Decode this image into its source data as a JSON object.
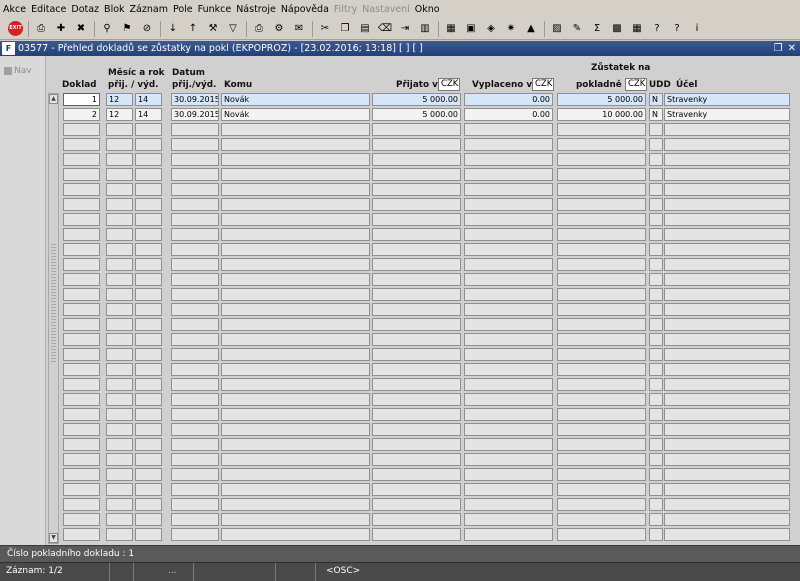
{
  "menu": [
    "Akce",
    "Editace",
    "Dotaz",
    "Blok",
    "Záznam",
    "Pole",
    "Funkce",
    "Nástroje",
    "Nápověda",
    "Filtry",
    "Nastavení",
    "Okno"
  ],
  "menu_disabled": [
    "Filtry",
    "Nastavení"
  ],
  "toolbar": {
    "exit_label": "EXIT",
    "icons": [
      "exit-icon",
      "sep",
      "print-preview-icon",
      "new-record-icon",
      "delete-record-icon",
      "sep",
      "query-icon",
      "execute-query-icon",
      "cancel-query-icon",
      "sep",
      "sort-asc-icon",
      "sort-desc-icon",
      "tools-icon",
      "filter-icon",
      "sep",
      "print-icon",
      "print-setup-icon",
      "mail-icon",
      "sep",
      "cut-icon",
      "copy-icon",
      "paste-icon",
      "clear-icon",
      "indent-icon",
      "columns-icon",
      "sep",
      "form-icon",
      "save-icon",
      "cube-icon",
      "star-icon",
      "warning-icon",
      "sep",
      "report-icon",
      "note-icon",
      "sum-icon",
      "excel-icon",
      "calc-icon",
      "help-icon",
      "question-icon",
      "info-icon"
    ]
  },
  "window": {
    "title": "03577 - Přehled dokladů se zůstatky na pokl (EKPOPROZ) - [23.02.2016; 13:18] [ ] [ ]",
    "icon_label": "F"
  },
  "nav": {
    "label": "Nav"
  },
  "headers": {
    "doklad": "Doklad",
    "mesic_rok": "Měsíc a rok",
    "prij_vyd": "přij. / výd.",
    "datum": "Datum",
    "datum_sub": "přij./výd.",
    "komu": "Komu",
    "prijato": "Přijato v",
    "prijato_cur": "CZK",
    "vyplaceno": "Vyplaceno v",
    "vyplaceno_cur": "CZK",
    "zustatek": "Zůstatek na",
    "zustatek_sub": "pokladně v",
    "zustatek_cur": "CZK",
    "udd": "UDD",
    "ucel": "Účel"
  },
  "rows": [
    {
      "doklad": "1",
      "mesic": "12",
      "rok": "14",
      "datum": "30.09.2015",
      "komu": "Novák",
      "prijato": "5 000.00",
      "vyplaceno": "0.00",
      "zustatek": "5 000.00",
      "udd": "N",
      "ucel": "Stravenky"
    },
    {
      "doklad": "2",
      "mesic": "12",
      "rok": "14",
      "datum": "30.09.2015",
      "komu": "Novák",
      "prijato": "5 000.00",
      "vyplaceno": "0.00",
      "zustatek": "10 000.00",
      "udd": "N",
      "ucel": "Stravenky"
    }
  ],
  "empty_rows": 28,
  "status": {
    "hint": "Číslo pokladního dokladu : 1",
    "record": "Záznam: 1/2",
    "dots": "...",
    "mode": "<OSC>"
  },
  "colors": {
    "title_bar": "#22407a",
    "selected_row": "#d4e6f8",
    "cursor_border": "#d83030",
    "exit_button": "#d82020"
  }
}
